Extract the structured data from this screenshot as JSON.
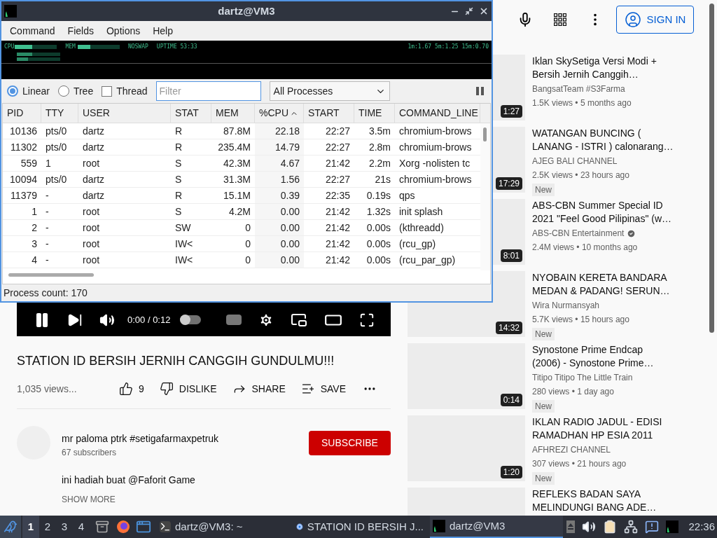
{
  "qps": {
    "title": "dartz@VM3",
    "menu": [
      "Command",
      "Fields",
      "Options",
      "Help"
    ],
    "meter": {
      "cpu": "CPU",
      "mem": "MEM",
      "swap": "NOSWAP",
      "uptime": "UPTIME 53:33",
      "load": "1m:1.67 5m:1.25 15m:0.70"
    },
    "views": [
      {
        "label": "Linear",
        "selected": true
      },
      {
        "label": "Tree",
        "selected": false
      }
    ],
    "thread": {
      "label": "Thread",
      "checked": false
    },
    "filter": {
      "placeholder": "Filter"
    },
    "process_filter": "All Processes",
    "columns": [
      {
        "label": "PID",
        "sorted": false
      },
      {
        "label": "TTY",
        "sorted": false
      },
      {
        "label": "USER",
        "sorted": false
      },
      {
        "label": "STAT",
        "sorted": false
      },
      {
        "label": "MEM",
        "sorted": false
      },
      {
        "label": "%CPU",
        "sorted": true
      },
      {
        "label": "START",
        "sorted": false
      },
      {
        "label": "TIME",
        "sorted": false
      },
      {
        "label": "COMMAND_LINE",
        "sorted": false
      }
    ],
    "rows": [
      [
        "10136",
        "pts/0",
        "dartz",
        "R",
        "87.8M",
        "22.18",
        "22:27",
        "3.5m",
        "chromium-brows"
      ],
      [
        "11302",
        "pts/0",
        "dartz",
        "R",
        "235.4M",
        "14.79",
        "22:27",
        "2.8m",
        "chromium-brows"
      ],
      [
        "559",
        "1",
        "root",
        "S",
        "42.3M",
        "4.67",
        "21:42",
        "2.2m",
        "Xorg -nolisten tc"
      ],
      [
        "10094",
        "pts/0",
        "dartz",
        "S",
        "31.3M",
        "1.56",
        "22:27",
        "21s",
        "chromium-brows"
      ],
      [
        "11379",
        "-",
        "dartz",
        "R",
        "15.1M",
        "0.39",
        "22:35",
        "0.19s",
        "qps"
      ],
      [
        "1",
        "-",
        "root",
        "S",
        "4.2M",
        "0.00",
        "21:42",
        "1.32s",
        "init splash"
      ],
      [
        "2",
        "-",
        "root",
        "SW",
        "0",
        "0.00",
        "21:42",
        "0.00s",
        "(kthreadd)"
      ],
      [
        "3",
        "-",
        "root",
        "IW<",
        "0",
        "0.00",
        "21:42",
        "0.00s",
        "(rcu_gp)"
      ],
      [
        "4",
        "-",
        "root",
        "IW<",
        "0",
        "0.00",
        "21:42",
        "0.00s",
        "(rcu_par_gp)"
      ]
    ],
    "status": "Process count: 170"
  },
  "browser": {
    "sign_in": "SIGN IN",
    "player": {
      "time": "0:00 / 0:12",
      "autoplay": false
    },
    "video": {
      "title": "STATION ID BERSIH JERNIH CANGGIH GUNDULMU!!!",
      "views": "1,035 views...",
      "likes": "9",
      "dislike": "DISLIKE",
      "share": "SHARE",
      "save": "SAVE",
      "channel": "mr paloma ptrk #setigafarmaxpetruk",
      "subscribers": "67 subscribers",
      "subscribe": "SUBSCRIBE",
      "description": "ini hadiah buat @Faforit Game",
      "show_more": "SHOW MORE"
    },
    "recommendations": [
      {
        "title": [
          "Iklan SkySetiga Versi Modi +",
          "Bersih Jernih Canggih…"
        ],
        "channel": "BangsatTeam #S3Farma",
        "verified": false,
        "meta": "1.5K views • 5 months ago",
        "new": false,
        "duration": "1:27"
      },
      {
        "title": [
          "WATANGAN BUNCING (",
          "LANANG - ISTRI ) calonarang…"
        ],
        "channel": "AJEG BALI CHANNEL",
        "verified": false,
        "meta": "2.5K views • 23 hours ago",
        "new": true,
        "new_label": "New",
        "duration": "17:29"
      },
      {
        "title": [
          "ABS-CBN Summer Special ID",
          "2021 \"Feel Good Pilipinas\" (w…"
        ],
        "channel": "ABS-CBN Entertainment",
        "verified": true,
        "meta": "2.4M views • 10 months ago",
        "new": false,
        "duration": "8:01"
      },
      {
        "title": [
          "NYOBAIN KERETA BANDARA",
          "MEDAN & PADANG! SERUN…"
        ],
        "channel": "Wira Nurmansyah",
        "verified": false,
        "meta": "5.7K views • 15 hours ago",
        "new": true,
        "new_label": "New",
        "duration": "14:32"
      },
      {
        "title": [
          "Synostone Prime Endcap",
          "(2006) - Synostone Prime…"
        ],
        "channel": "Titipo Titipo The Little Train",
        "verified": false,
        "meta": "280 views • 1 day ago",
        "new": true,
        "new_label": "New",
        "duration": "0:14"
      },
      {
        "title": [
          "IKLAN RADIO JADUL - EDISI",
          "RAMADHAN HP ESIA 2011"
        ],
        "channel": "AFHREZI CHANNEL",
        "verified": false,
        "meta": "307 views • 21 hours ago",
        "new": true,
        "new_label": "New",
        "duration": "1:20"
      },
      {
        "title": [
          "REFLEKS BADAN SAYA",
          "MELINDUNGI BANG ADE…"
        ],
        "new": false
      }
    ]
  },
  "taskbar": {
    "workspaces": [
      {
        "label": "1",
        "selected": true
      },
      {
        "label": "2",
        "selected": false
      },
      {
        "label": "3",
        "selected": false
      },
      {
        "label": "4",
        "selected": false
      }
    ],
    "tasks": [
      {
        "kind": "terminal",
        "label": "dartz@VM3: ~",
        "active": false
      },
      {
        "kind": "browser",
        "label": "STATION ID BERSIH J...",
        "active": false
      },
      {
        "kind": "monitor",
        "label": "dartz@VM3",
        "active": true
      }
    ],
    "clock": "22:36"
  }
}
